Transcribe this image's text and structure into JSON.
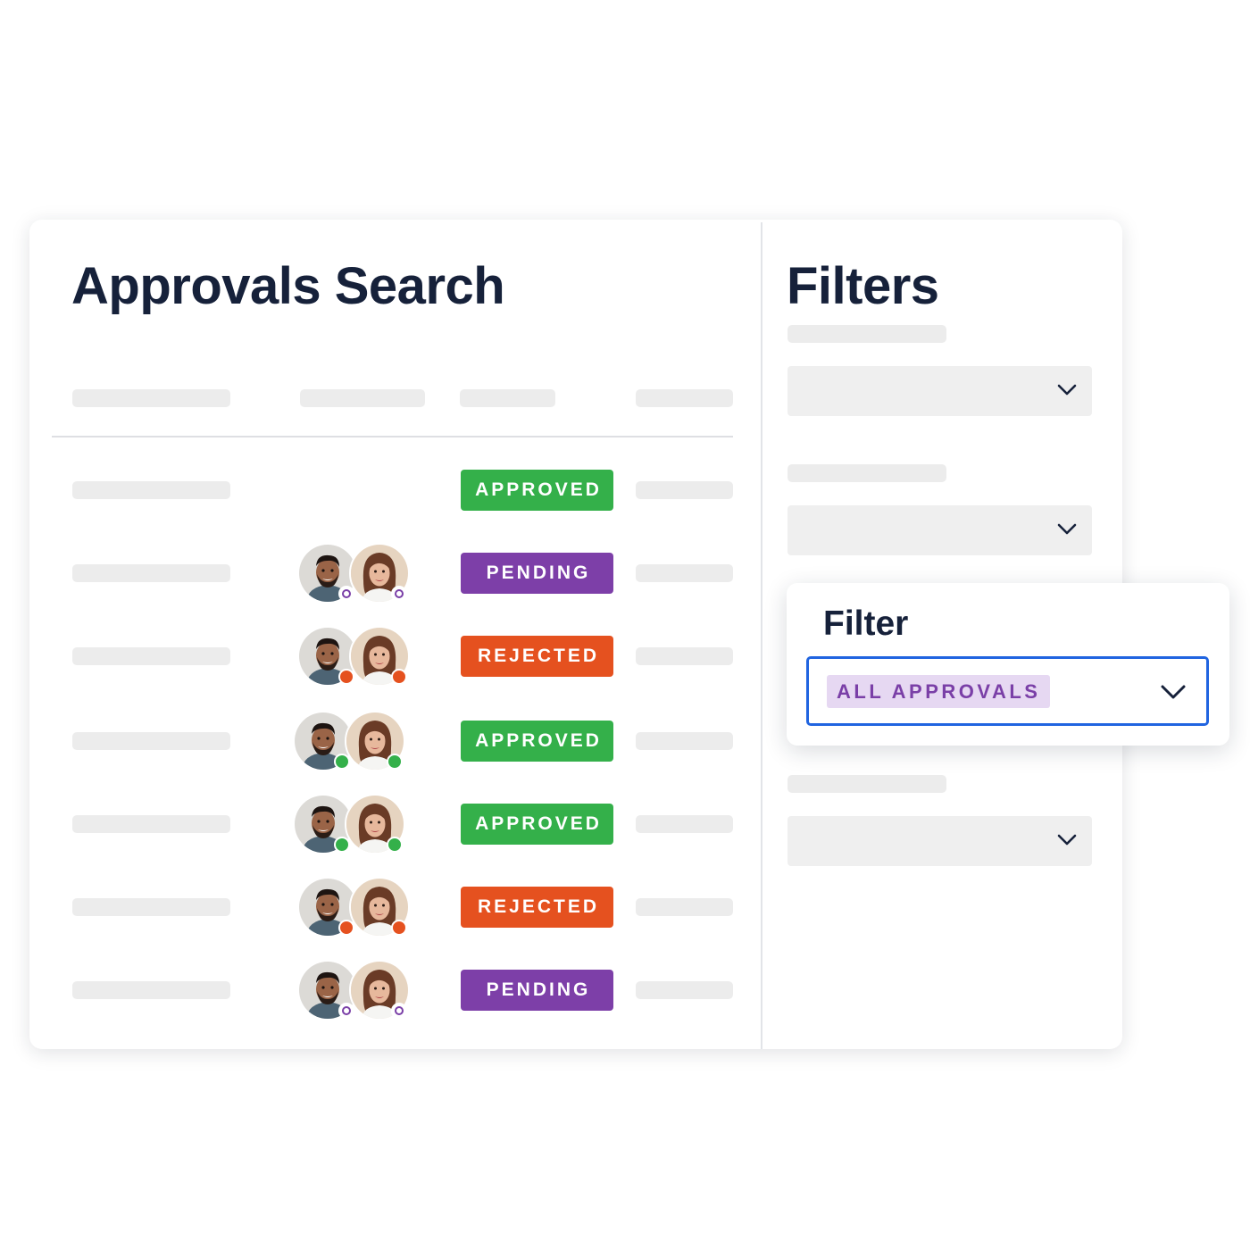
{
  "main": {
    "title": "Approvals Search",
    "rows": [
      {
        "status": "APPROVED",
        "status_color": "#34b04a",
        "has_avatars": false,
        "dot_color": ""
      },
      {
        "status": "PENDING",
        "status_color": "#7d3fa8",
        "has_avatars": true,
        "dot_color": "pending"
      },
      {
        "status": "REJECTED",
        "status_color": "#e5511f",
        "has_avatars": true,
        "dot_color": "#e5511f"
      },
      {
        "status": "APPROVED",
        "status_color": "#34b04a",
        "has_avatars": true,
        "dot_color": "#34b04a"
      },
      {
        "status": "APPROVED",
        "status_color": "#34b04a",
        "has_avatars": true,
        "dot_color": "#34b04a"
      },
      {
        "status": "REJECTED",
        "status_color": "#e5511f",
        "has_avatars": true,
        "dot_color": "#e5511f"
      },
      {
        "status": "PENDING",
        "status_color": "#7d3fa8",
        "has_avatars": true,
        "dot_color": "pending"
      }
    ]
  },
  "sidebar": {
    "title": "Filters"
  },
  "filter_popup": {
    "title": "Filter",
    "selected_value": "ALL APPROVALS",
    "selected_color": "#7a3fa7",
    "focus_color": "#2064e0"
  },
  "icons": {
    "dropdown": "chevron-down-icon",
    "avatar_man": "user-avatar",
    "avatar_woman": "user-avatar"
  },
  "colors": {
    "title_text": "#16213a",
    "placeholder": "#ececec"
  }
}
